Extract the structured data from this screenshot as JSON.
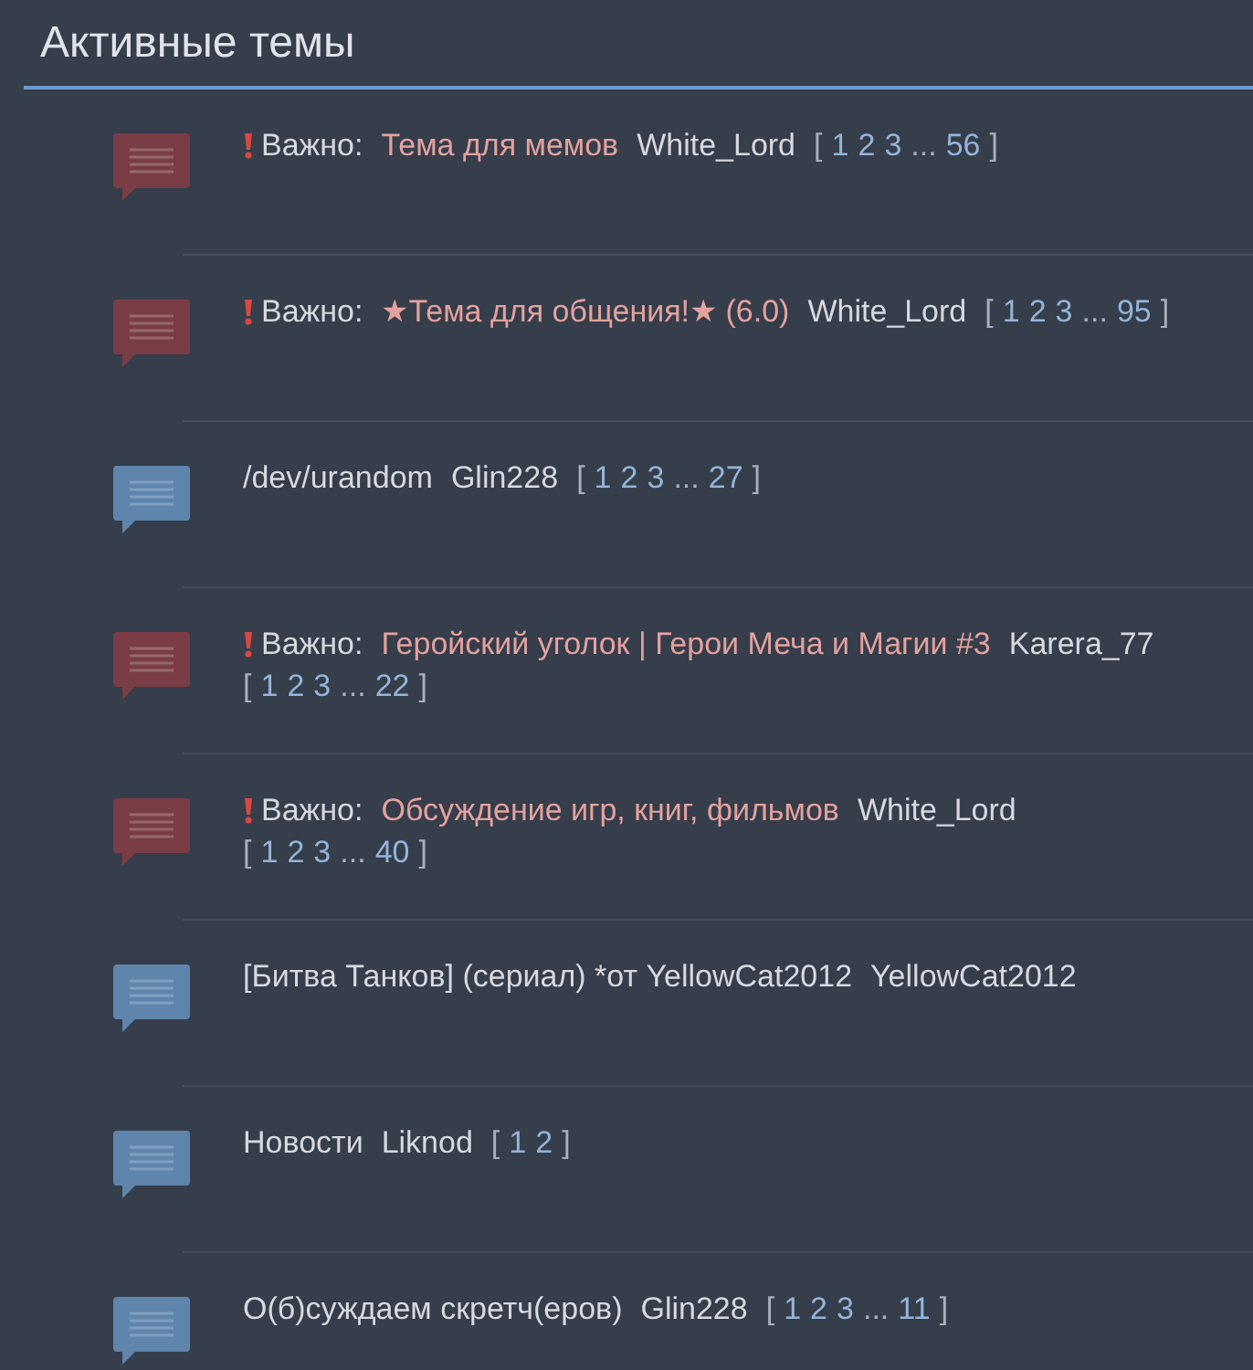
{
  "header": {
    "title": "Активные темы"
  },
  "topics": [
    {
      "kind": "sticky",
      "prefix": "Важно:",
      "title": "Тема для мемов",
      "author": "White_Lord",
      "pager": {
        "open": "[",
        "pages": [
          {
            "kind": "link",
            "text": "1"
          },
          {
            "kind": "link",
            "text": "2"
          },
          {
            "kind": "link",
            "text": "3"
          },
          {
            "kind": "gap",
            "text": "..."
          },
          {
            "kind": "link",
            "text": "56"
          }
        ],
        "close": "]"
      }
    },
    {
      "kind": "sticky",
      "prefix": "Важно:",
      "title": "★Тема для общения!★ (6.0)",
      "author": "White_Lord",
      "pager": {
        "open": "[",
        "pages": [
          {
            "kind": "link",
            "text": "1"
          },
          {
            "kind": "link",
            "text": "2"
          },
          {
            "kind": "link",
            "text": "3"
          },
          {
            "kind": "gap",
            "text": "..."
          },
          {
            "kind": "link",
            "text": "95"
          }
        ],
        "close": "]"
      }
    },
    {
      "kind": "normal",
      "title": "/dev/urandom",
      "author": "Glin228",
      "pager": {
        "open": "[",
        "pages": [
          {
            "kind": "link",
            "text": "1"
          },
          {
            "kind": "link",
            "text": "2"
          },
          {
            "kind": "link",
            "text": "3"
          },
          {
            "kind": "gap",
            "text": "..."
          },
          {
            "kind": "link",
            "text": "27"
          }
        ],
        "close": "]"
      }
    },
    {
      "kind": "sticky",
      "prefix": "Важно:",
      "title": "Геройский уголок | Герои Меча и Магии #3",
      "author": "Karera_77",
      "pager": {
        "open": "[",
        "pages": [
          {
            "kind": "link",
            "text": "1"
          },
          {
            "kind": "link",
            "text": "2"
          },
          {
            "kind": "link",
            "text": "3"
          },
          {
            "kind": "gap",
            "text": "..."
          },
          {
            "kind": "link",
            "text": "22"
          }
        ],
        "close": "]"
      }
    },
    {
      "kind": "sticky",
      "prefix": "Важно:",
      "title": "Обсуждение игр, книг, фильмов",
      "author": "White_Lord",
      "pager": {
        "open": "[",
        "pages": [
          {
            "kind": "link",
            "text": "1"
          },
          {
            "kind": "link",
            "text": "2"
          },
          {
            "kind": "link",
            "text": "3"
          },
          {
            "kind": "gap",
            "text": "..."
          },
          {
            "kind": "link",
            "text": "40"
          }
        ],
        "close": "]"
      }
    },
    {
      "kind": "normal",
      "title": "[Битва Танков] (сериал) *от YellowCat2012",
      "author": "YellowCat2012"
    },
    {
      "kind": "normal",
      "title": "Новости",
      "author": "Liknod",
      "pager": {
        "open": "[",
        "pages": [
          {
            "kind": "link",
            "text": "1"
          },
          {
            "kind": "link",
            "text": "2"
          }
        ],
        "close": "]"
      }
    },
    {
      "kind": "normal",
      "title": "О(б)суждаем скретч(еров)",
      "author": "Glin228",
      "pager": {
        "open": "[",
        "pages": [
          {
            "kind": "link",
            "text": "1"
          },
          {
            "kind": "link",
            "text": "2"
          },
          {
            "kind": "link",
            "text": "3"
          },
          {
            "kind": "gap",
            "text": "..."
          },
          {
            "kind": "link",
            "text": "11"
          }
        ],
        "close": "]"
      }
    }
  ]
}
